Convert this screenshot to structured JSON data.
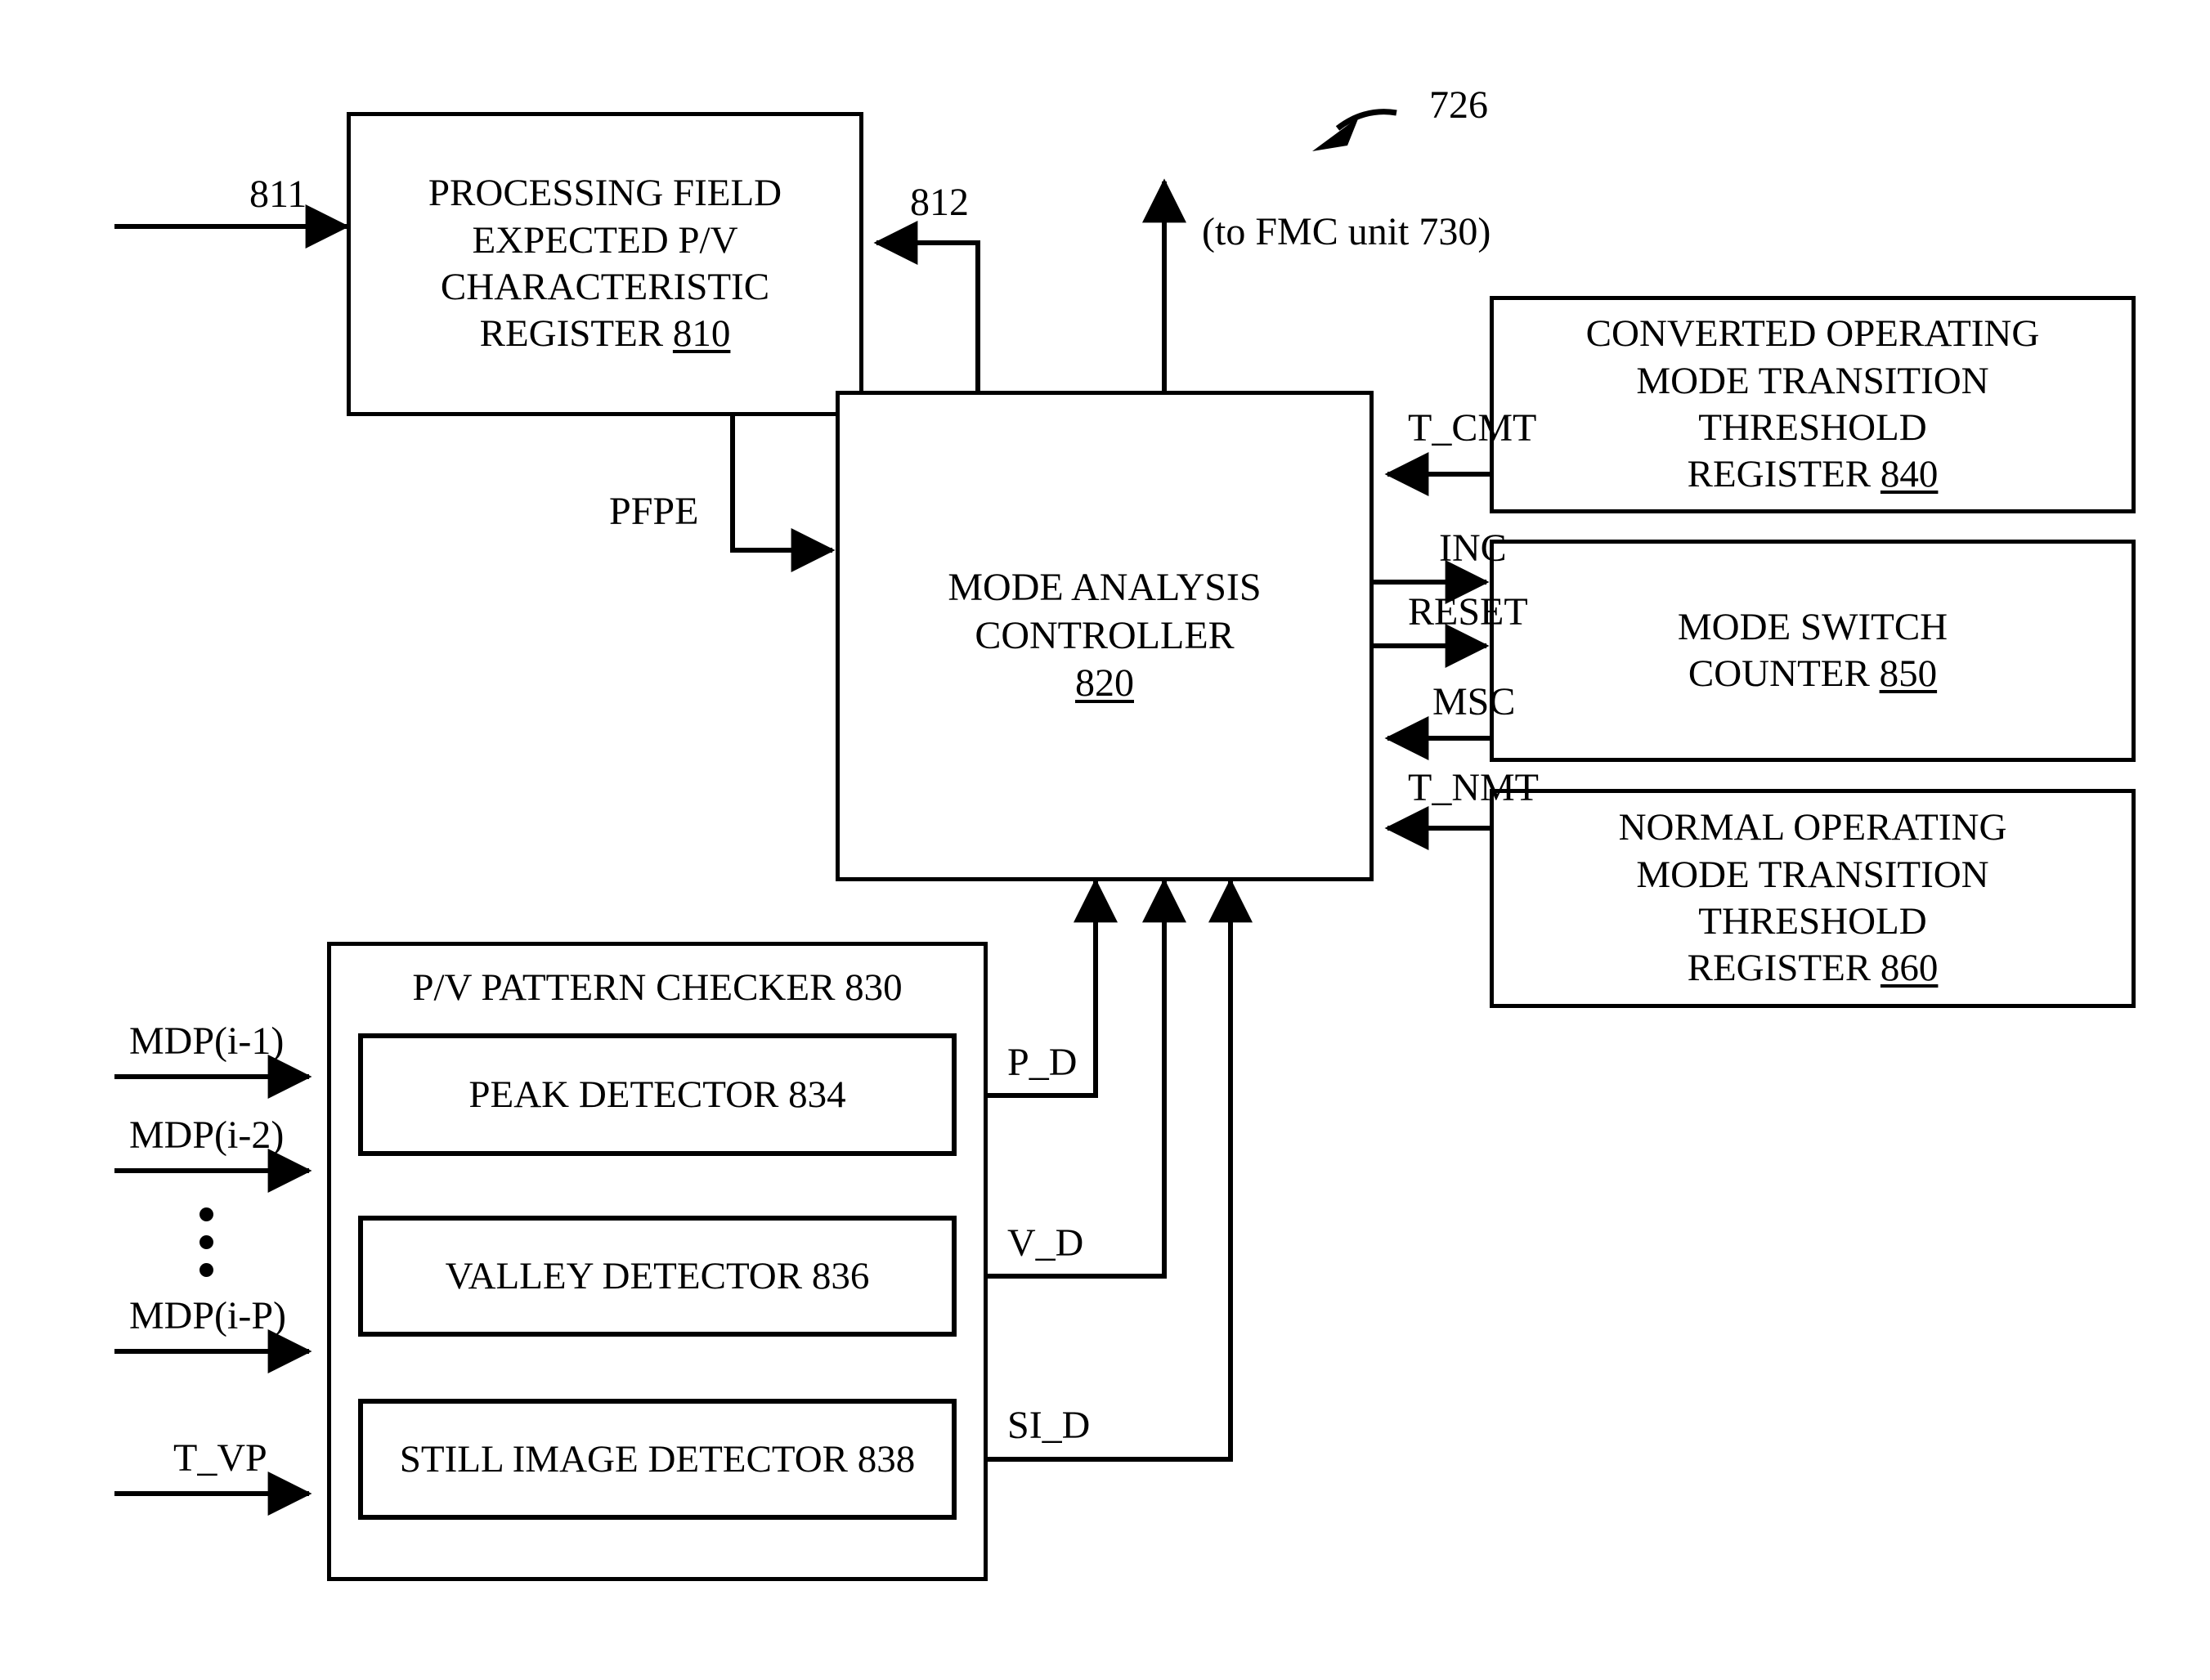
{
  "figure": {
    "reference_numeral": "726",
    "note_to_fmc": "(to FMC unit 730)"
  },
  "boxes": {
    "pfe_register": {
      "lines": [
        "PROCESSING FIELD",
        "EXPECTED P/V",
        "CHARACTERISTIC",
        "REGISTER "
      ],
      "ref": "810"
    },
    "mode_analysis_controller": {
      "lines": [
        "MODE ANALYSIS",
        "CONTROLLER"
      ],
      "ref": "820"
    },
    "converted_threshold_register": {
      "lines": [
        "CONVERTED OPERATING",
        "MODE TRANSITION",
        "THRESHOLD",
        "REGISTER "
      ],
      "ref": "840"
    },
    "mode_switch_counter": {
      "lines": [
        "MODE SWITCH",
        "COUNTER "
      ],
      "ref": "850"
    },
    "normal_threshold_register": {
      "lines": [
        "NORMAL OPERATING",
        "MODE TRANSITION",
        "THRESHOLD",
        "REGISTER "
      ],
      "ref": "860"
    },
    "pv_pattern_checker": {
      "title": "P/V PATTERN CHECKER 830",
      "peak_detector": "PEAK DETECTOR 834",
      "valley_detector": "VALLEY DETECTOR 836",
      "still_image_detector": "STILL IMAGE DETECTOR 838"
    }
  },
  "signals": {
    "input_811": "811",
    "feedback_812": "812",
    "pfpe": "PFPE",
    "t_cmt": "T_CMT",
    "inc": "INC",
    "reset": "RESET",
    "msc": "MSC",
    "t_nmt": "T_NMT",
    "mdp_i1": "MDP(i-1)",
    "mdp_i2": "MDP(i-2)",
    "mdp_ip": "MDP(i-P)",
    "t_vp": "T_VP",
    "p_d": "P_D",
    "v_d": "V_D",
    "si_d": "SI_D"
  }
}
